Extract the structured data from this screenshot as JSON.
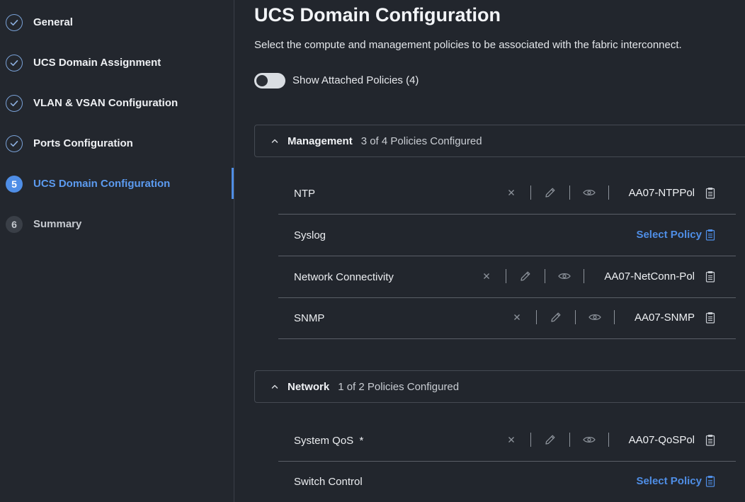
{
  "sidebar": {
    "steps": [
      {
        "label": "General",
        "state": "done"
      },
      {
        "label": "UCS Domain Assignment",
        "state": "done"
      },
      {
        "label": "VLAN & VSAN Configuration",
        "state": "done"
      },
      {
        "label": "Ports Configuration",
        "state": "done"
      },
      {
        "label": "UCS Domain Configuration",
        "state": "active",
        "number": "5"
      },
      {
        "label": "Summary",
        "state": "pending",
        "number": "6"
      }
    ]
  },
  "main": {
    "title": "UCS Domain Configuration",
    "description": "Select the compute and management policies to be associated with the fabric interconnect.",
    "toggle_label": "Show Attached Policies (4)",
    "toggle_on": false
  },
  "sections": {
    "management": {
      "title": "Management",
      "count": "3 of 4 Policies Configured",
      "rows": {
        "ntp": {
          "label": "NTP",
          "policy": "AA07-NTPPol"
        },
        "syslog": {
          "label": "Syslog",
          "action": "Select Policy"
        },
        "netconn": {
          "label": "Network Connectivity",
          "policy": "AA07-NetConn-Pol"
        },
        "snmp": {
          "label": "SNMP",
          "policy": "AA07-SNMP"
        }
      }
    },
    "network": {
      "title": "Network",
      "count": "1 of 2 Policies Configured",
      "rows": {
        "qos": {
          "label": "System QoS  *",
          "policy": "AA07-QoSPol"
        },
        "switch": {
          "label": "Switch Control",
          "action": "Select Policy"
        }
      }
    }
  },
  "icons": {
    "step_done": "check-circle-icon",
    "remove": "close-icon",
    "edit": "pencil-icon",
    "view": "eye-icon",
    "copy": "clipboard-icon",
    "collapse": "chevron-up-icon"
  },
  "colors": {
    "background": "#22262d",
    "accent": "#4f8ee6",
    "text": "#e6e8ec",
    "divider": "#5a5f67"
  }
}
